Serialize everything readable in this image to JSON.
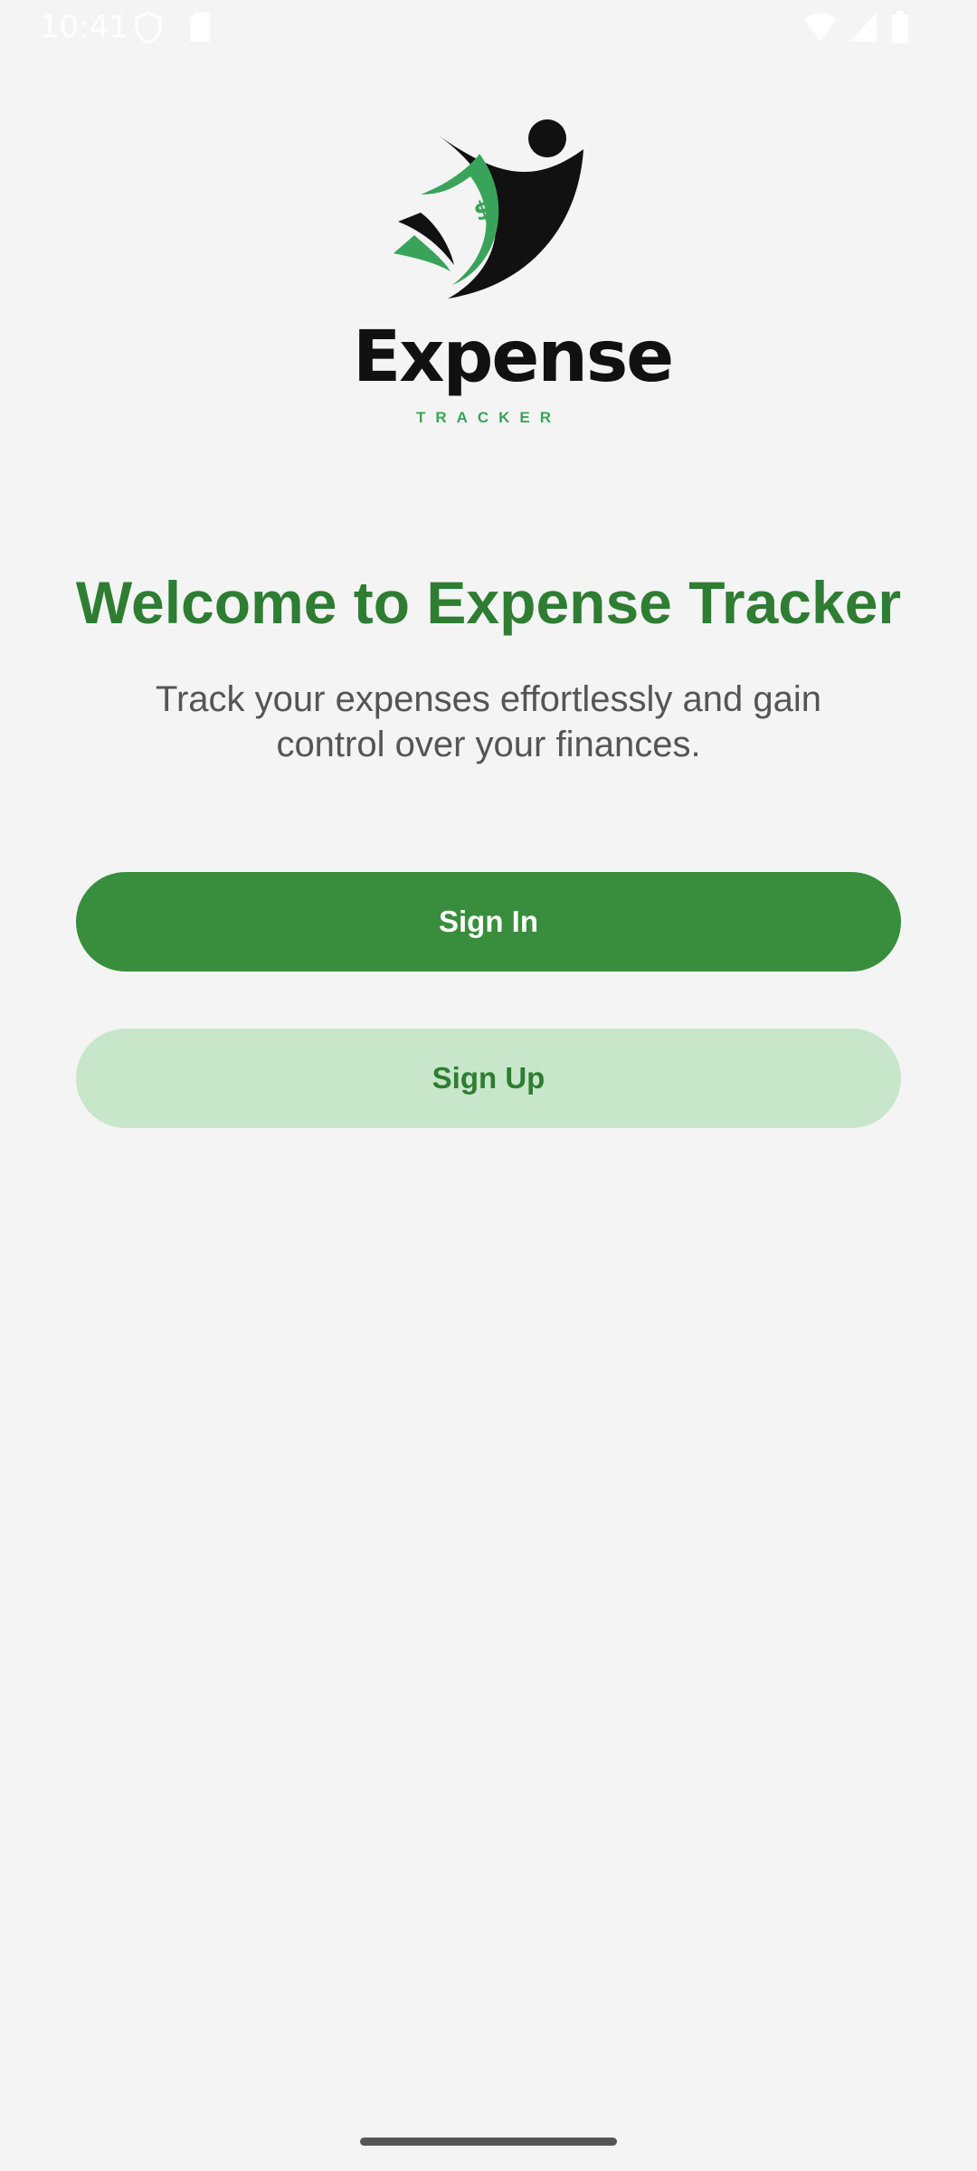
{
  "status_bar": {
    "time": "10:41",
    "icons": [
      "shield-icon",
      "sd-card-icon",
      "wifi-icon",
      "signal-icon",
      "battery-icon"
    ]
  },
  "logo": {
    "word": "Expense",
    "sub": "TRACKER"
  },
  "welcome": {
    "title": "Welcome to Expense Tracker",
    "subtitle": "Track your expenses effortlessly and gain control over your finances."
  },
  "buttons": {
    "sign_in": "Sign In",
    "sign_up": "Sign Up"
  },
  "colors": {
    "primary": "#388e3c",
    "title": "#2e7d32",
    "secondary_bg": "#c8e6c9",
    "background": "#f4f4f4"
  }
}
